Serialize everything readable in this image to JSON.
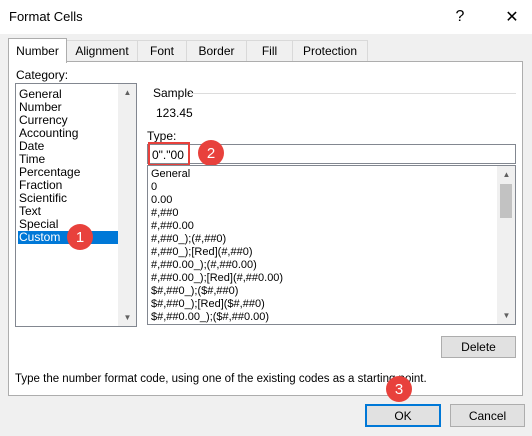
{
  "window": {
    "title": "Format Cells",
    "help_glyph": "?",
    "close_glyph": "✕"
  },
  "tabs": [
    {
      "label": "Number",
      "active": true
    },
    {
      "label": "Alignment"
    },
    {
      "label": "Font"
    },
    {
      "label": "Border"
    },
    {
      "label": "Fill"
    },
    {
      "label": "Protection"
    }
  ],
  "category": {
    "label": "Category:",
    "items": [
      "General",
      "Number",
      "Currency",
      "Accounting",
      "Date",
      "Time",
      "Percentage",
      "Fraction",
      "Scientific",
      "Text",
      "Special",
      "Custom"
    ],
    "selected": "Custom"
  },
  "sample": {
    "label": "Sample",
    "value": "123.45"
  },
  "type_field": {
    "label": "Type:",
    "value": "0\".\"00"
  },
  "format_list": [
    "General",
    "0",
    "0.00",
    "#,##0",
    "#,##0.00",
    "#,##0_);(#,##0)",
    "#,##0_);[Red](#,##0)",
    "#,##0.00_);(#,##0.00)",
    "#,##0.00_);[Red](#,##0.00)",
    "$#,##0_);($#,##0)",
    "$#,##0_);[Red]($#,##0)",
    "$#,##0.00_);($#,##0.00)"
  ],
  "delete_button": "Delete",
  "hint_text": "Type the number format code, using one of the existing codes as a starting point.",
  "buttons": {
    "ok": "OK",
    "cancel": "Cancel"
  },
  "badges": [
    "1",
    "2",
    "3"
  ],
  "colors": {
    "accent": "#0078d7",
    "badge": "#e8413c"
  },
  "icons": {
    "scroll_up": "scroll-up-arrow-icon",
    "scroll_down": "scroll-down-arrow-icon"
  }
}
